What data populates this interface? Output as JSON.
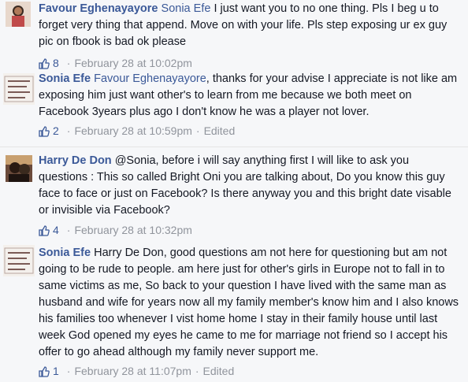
{
  "comments": [
    {
      "author": "Favour Eghenayayore",
      "mention": "Sonia Efe",
      "text": " I just want you to no one thing. Pls I beg u to forget very thing that append. Move on with your life. Pls step exposing ur ex guy pic on fbook is bad ok please",
      "likes": "8",
      "sep": "·",
      "date": "February 28 at 10:02pm",
      "edited": ""
    },
    {
      "author": "Sonia Efe",
      "mention": "Favour Eghenayayore",
      "text": ", thanks for your advise I appreciate is not like am exposing him just want other's to learn from me because we both meet on Facebook 3years plus ago I don't know he was a player not lover.",
      "likes": "2",
      "sep": "·",
      "date": "February 28 at 10:59pm",
      "edited": "Edited"
    },
    {
      "author": "Harry De Don",
      "mention": "",
      "text": "@Sonia, before i will say anything first I will like to ask you questions : This so called Bright Oni you are talking about, Do you know this guy face to face or just on Facebook? Is there anyway you and this bright date visable or invisible via Facebook?",
      "likes": "4",
      "sep": "·",
      "date": "February 28 at 10:32pm",
      "edited": ""
    },
    {
      "author": "Sonia Efe",
      "mention": "",
      "text": "Harry De Don, good questions am not here for questioning but am not going to be rude to people. am here just for other's girls in Europe not to fall in to same victims as me, So back to your question I have lived with the same man as husband and wife for years now all my family member's know him and I also knows his families too whenever I vist home home I stay in their family house until last week God opened my eyes he came to me for marriage not friend so I accept his offer to go ahead although my family never support me.",
      "likes": "1",
      "sep": "·",
      "date": "February 28 at 11:07pm",
      "edited": "Edited"
    }
  ]
}
